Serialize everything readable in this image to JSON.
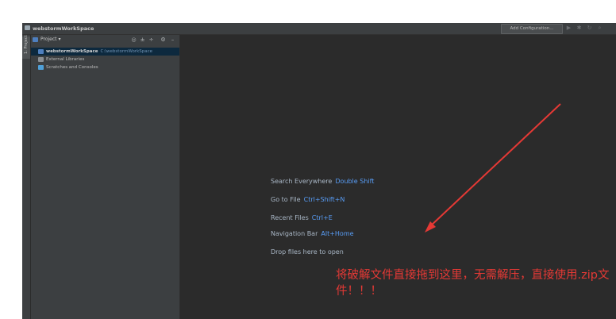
{
  "window": {
    "title": "webstormWorkSpace",
    "add_configuration": "Add Configuration..."
  },
  "left_strip": {
    "tab_label": "1: Project"
  },
  "project_panel": {
    "header_label": "Project",
    "tree": [
      {
        "name": "webstormWorkSpace",
        "path": "C:\\webstormWorkSpace",
        "selected": true
      },
      {
        "name": "External Libraries",
        "path": ""
      },
      {
        "name": "Scratches and Consoles",
        "path": ""
      }
    ]
  },
  "editor": {
    "hints": [
      {
        "label": "Search Everywhere",
        "shortcut": "Double Shift"
      },
      {
        "label": "Go to File",
        "shortcut": "Ctrl+Shift+N"
      },
      {
        "label": "Recent Files",
        "shortcut": "Ctrl+E"
      },
      {
        "label": "Navigation Bar",
        "shortcut": "Alt+Home"
      },
      {
        "label": "Drop files here to open",
        "shortcut": ""
      }
    ]
  },
  "annotation": {
    "text": "将破解文件直接拖到这里，无需解压，直接使用.zip文件！！！",
    "color": "#e53935"
  },
  "colors": {
    "ide_background": "#2b2b2b",
    "panel_background": "#3c3f41",
    "shortcut_blue": "#589df6",
    "arrow_red": "#e53935"
  }
}
